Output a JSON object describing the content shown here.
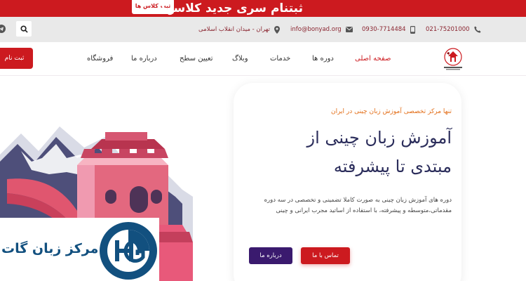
{
  "topbar": {
    "announcement": "ثبتنام سری جدید کلاسها",
    "register_small": "ثبت کلاس ها"
  },
  "info": {
    "phone1": "021-75201000",
    "phone2": "0930-7714484",
    "email": "info@bonyad.org",
    "address": "تهران - میدان انقلاب اسلامی"
  },
  "header": {
    "register_label": "ثبت نام",
    "nav": [
      "صفحه اصلی",
      "دوره ها",
      "خدمات",
      "وبلاگ",
      "تعیین سطح",
      "درباره ما",
      "فروشگاه"
    ]
  },
  "hero": {
    "kicker": "تنها مرکز تخصصی آموزش زبان چینی در ایران",
    "title_line1": "آموزش زبان چینی از",
    "title_line2": "مبتدی تا پیشرفته",
    "description": "دوره های آموزش زبان چینی به صورت کاملا تضمینی و تخصصی در سه دوره مقدماتی،متوسطه و پیشرفته، با  استفاده از اساتید مجرب ایرانی و چینی",
    "contact_label": "تماس با ما",
    "about_label": "درباره ما"
  },
  "overlay": {
    "brand_text": "مرکز زبان گات"
  },
  "colors": {
    "brand_red": "#cc1a1f",
    "nav_purple": "#3a1a6e",
    "title_navy": "#2b2d5b",
    "kicker_orange": "#e36f1a",
    "gate_blue": "#12507f"
  }
}
